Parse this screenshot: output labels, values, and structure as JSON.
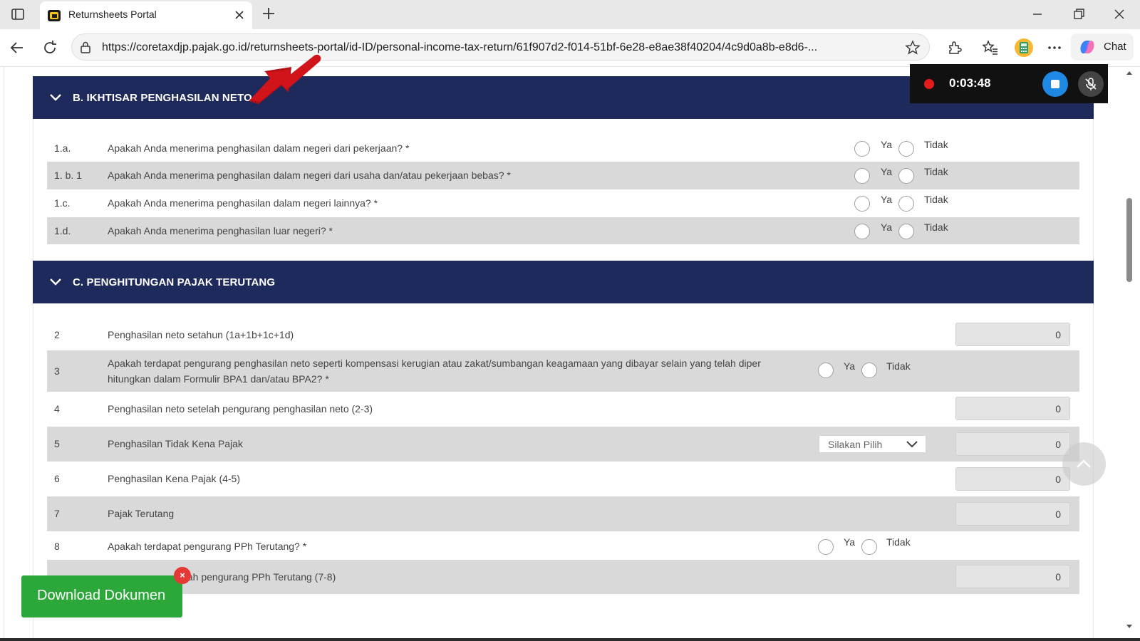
{
  "browser": {
    "tab_title": "Returnsheets Portal",
    "url": "https://coretaxdjp.pajak.go.id/returnsheets-portal/id-ID/personal-income-tax-return/61f907d2-f014-51bf-6e28-e8ae38f40204/4c9d0a8b-e8d6-...",
    "chat_label": "Chat"
  },
  "recording": {
    "time": "0:03:48"
  },
  "section_b": {
    "title": "B. IKHTISAR PENGHASILAN NETO",
    "rows": [
      {
        "num": "1.a.",
        "question": "Apakah Anda menerima penghasilan dalam negeri dari pekerjaan? *",
        "yes": "Ya",
        "no": "Tidak"
      },
      {
        "num": "1. b. 1",
        "question": "Apakah Anda menerima penghasilan dalam negeri dari usaha dan/atau pekerjaan bebas? *",
        "yes": "Ya",
        "no": "Tidak"
      },
      {
        "num": "1.c.",
        "question": "Apakah Anda menerima penghasilan dalam negeri lainnya? *",
        "yes": "Ya",
        "no": "Tidak"
      },
      {
        "num": "1.d.",
        "question": "Apakah Anda menerima penghasilan luar negeri? *",
        "yes": "Ya",
        "no": "Tidak"
      }
    ]
  },
  "section_c": {
    "title": "C. PENGHITUNGAN PAJAK TERUTANG",
    "rows": [
      {
        "num": "2",
        "label": "Penghasilan neto setahun (1a+1b+1c+1d)",
        "value": "0"
      },
      {
        "num": "3",
        "label_line1": "Apakah terdapat pengurang penghasilan neto seperti kompensasi kerugian atau zakat/sumbangan keagamaan yang dibayar selain yang telah diper",
        "label_line2": "hitungkan dalam Formulir BPA1 dan/atau BPA2? *",
        "yes": "Ya",
        "no": "Tidak"
      },
      {
        "num": "4",
        "label": "Penghasilan neto setelah pengurang penghasilan neto (2-3)",
        "value": "0"
      },
      {
        "num": "5",
        "label": "Penghasilan Tidak Kena Pajak",
        "select": "Silakan Pilih",
        "value": "0"
      },
      {
        "num": "6",
        "label": "Penghasilan Kena Pajak (4-5)",
        "value": "0"
      },
      {
        "num": "7",
        "label": "Pajak Terutang",
        "value": "0"
      },
      {
        "num": "8",
        "label": "Apakah terdapat pengurang PPh Terutang? *",
        "yes": "Ya",
        "no": "Tidak"
      },
      {
        "label": "elah pengurang PPh Terutang (7-8)",
        "value": "0"
      }
    ]
  },
  "download": {
    "label": "Download Dokumen",
    "close": "×"
  },
  "colors": {
    "header_navy": "#1f2a5c",
    "download_green": "#2ca83a",
    "annotation_red": "#d0141a"
  }
}
